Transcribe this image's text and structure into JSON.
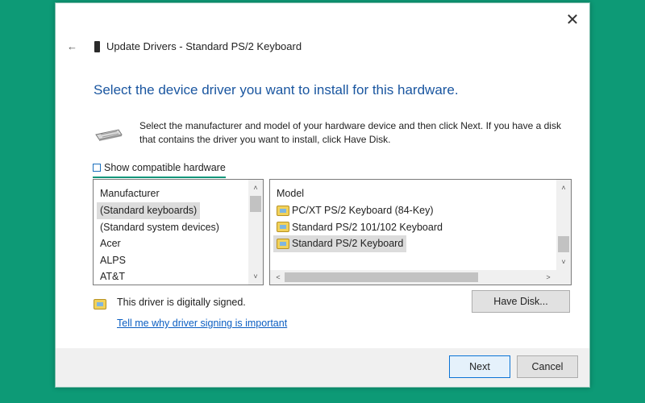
{
  "window": {
    "title": "Update Drivers - Standard PS/2 Keyboard",
    "close_glyph": "✕",
    "back_glyph": "←"
  },
  "heading": "Select the device driver you want to install for this hardware.",
  "description": "Select the manufacturer and model of your hardware device and then click Next. If you have a disk that contains the driver you want to install, click Have Disk.",
  "compatible": {
    "label": "Show compatible hardware",
    "checked": false
  },
  "manufacturer_list": {
    "header": "Manufacturer",
    "items": [
      {
        "label": "(Standard keyboards)",
        "selected": true
      },
      {
        "label": "(Standard system devices)",
        "selected": false
      },
      {
        "label": "Acer",
        "selected": false
      },
      {
        "label": "ALPS",
        "selected": false
      },
      {
        "label": "AT&T",
        "selected": false
      }
    ]
  },
  "model_list": {
    "header": "Model",
    "items": [
      {
        "label": "PC/XT PS/2 Keyboard (84-Key)",
        "selected": false
      },
      {
        "label": "Standard PS/2 101/102 Keyboard",
        "selected": false
      },
      {
        "label": "Standard PS/2 Keyboard",
        "selected": true
      }
    ]
  },
  "signing": {
    "status": "This driver is digitally signed.",
    "link": "Tell me why driver signing is important"
  },
  "buttons": {
    "have_disk": "Have Disk...",
    "next": "Next",
    "cancel": "Cancel"
  },
  "scroll_glyphs": {
    "up": "˄",
    "down": "˅",
    "left": "<",
    "right": ">"
  },
  "colors": {
    "background": "#0d9a76",
    "heading": "#1a56a0",
    "link": "#0b5ec2",
    "accent_underline": "#13967a"
  },
  "icons": {
    "device": "keyboard-device-icon",
    "keyboard": "keyboard-icon",
    "certificate": "certificate-icon"
  }
}
